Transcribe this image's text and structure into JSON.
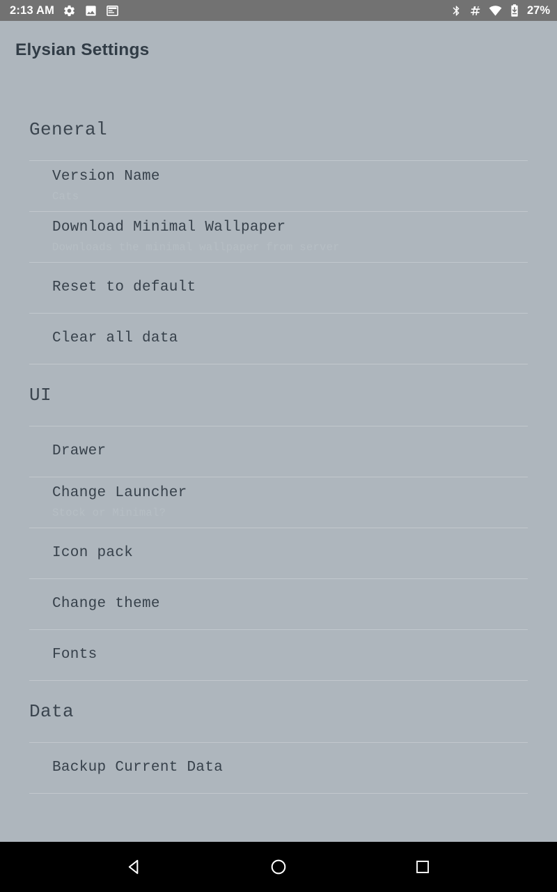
{
  "status_bar": {
    "clock": "2:13 AM",
    "left_icons": [
      "gear-icon",
      "image-icon",
      "window-icon"
    ],
    "right_icons": [
      "bluetooth-icon",
      "hash-icon",
      "wifi-icon",
      "battery-icon"
    ],
    "battery_level": "27%",
    "background_color": "#727272",
    "foreground_color": "#ffffff"
  },
  "app_bar": {
    "title": "Elysian Settings"
  },
  "theme": {
    "background": "#aeb6bd",
    "title_color": "#313c46",
    "row_title_color": "#37414b",
    "row_sub_color": "#b6bec4",
    "divider_color": "#c2c8cd",
    "nav_background": "#000000"
  },
  "sections": [
    {
      "header": "General",
      "rows": [
        {
          "title": "Version Name",
          "subtitle": "Cats"
        },
        {
          "title": "Download Minimal Wallpaper",
          "subtitle": "Downloads the minimal wallpaper from server"
        },
        {
          "title": "Reset to default",
          "subtitle": ""
        },
        {
          "title": "Clear all data",
          "subtitle": ""
        }
      ]
    },
    {
      "header": "UI",
      "rows": [
        {
          "title": "Drawer",
          "subtitle": ""
        },
        {
          "title": "Change Launcher",
          "subtitle": "Stock or Minimal?"
        },
        {
          "title": "Icon pack",
          "subtitle": ""
        },
        {
          "title": "Change theme",
          "subtitle": ""
        },
        {
          "title": "Fonts",
          "subtitle": ""
        }
      ]
    },
    {
      "header": "Data",
      "rows": [
        {
          "title": "Backup Current Data",
          "subtitle": ""
        }
      ]
    }
  ],
  "nav_bar": {
    "buttons": [
      {
        "name": "back-icon",
        "label": "Back"
      },
      {
        "name": "home-icon",
        "label": "Home"
      },
      {
        "name": "recents-icon",
        "label": "Recents"
      }
    ]
  }
}
